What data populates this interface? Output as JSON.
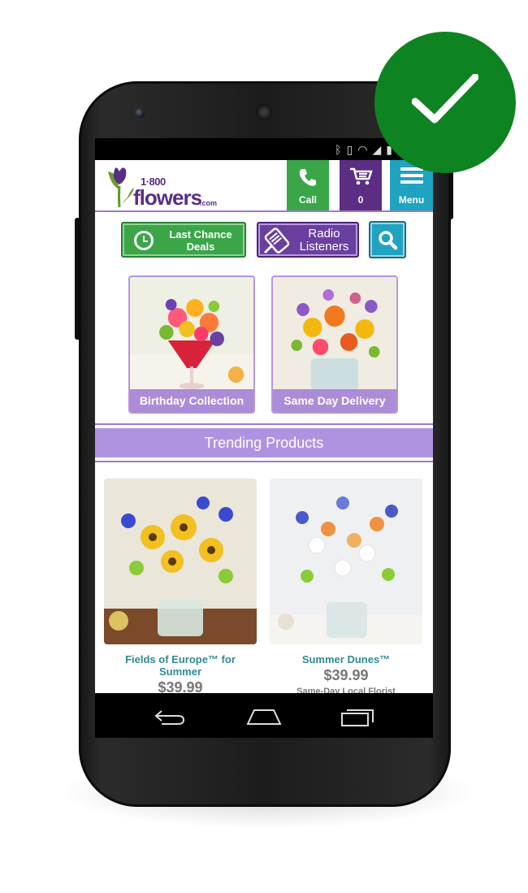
{
  "header": {
    "logo": {
      "digits": "1·800",
      "word": "flowers",
      "suffix": ".com"
    },
    "call_label": "Call",
    "cart_count": "0",
    "menu_label": "Menu"
  },
  "quick_actions": {
    "deals_label": "Last Chance Deals",
    "radio_label": "Radio Listeners"
  },
  "collections": [
    {
      "label": "Birthday Collection"
    },
    {
      "label": "Same Day Delivery"
    }
  ],
  "trending": {
    "title": "Trending Products",
    "products": [
      {
        "name": "Fields of Europe™ for Summer",
        "price": "$39.99"
      },
      {
        "name": "Summer Dunes™",
        "price": "$39.99",
        "note": "Same-Day Local Florist"
      }
    ]
  },
  "colors": {
    "brand_purple": "#5b2d83",
    "call_green": "#3aa648",
    "menu_blue": "#1fa3c0",
    "badge_green": "#0e8321"
  },
  "icons": [
    "phone-icon",
    "cart-icon",
    "menu-icon",
    "clock-icon",
    "radio-icon",
    "search-icon",
    "back-icon",
    "home-icon",
    "recents-icon",
    "checkmark-icon"
  ]
}
